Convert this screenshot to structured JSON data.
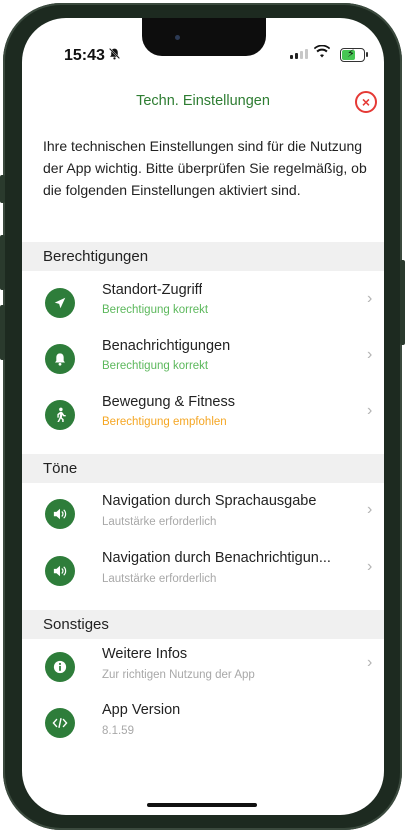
{
  "status_bar": {
    "time": "15:43",
    "mute_icon": "bell-slash-icon"
  },
  "header": {
    "title": "Techn. Einstellungen"
  },
  "intro_text": "Ihre technischen Einstellungen sind für die Nutzung der App wichtig. Bitte überprüfen Sie regelmäßig, ob die folgenden Einstellungen aktiviert sind.",
  "sections": {
    "permissions": {
      "title": "Berechtigungen",
      "items": [
        {
          "title": "Standort-Zugriff",
          "subtitle": "Berechtigung korrekt",
          "icon": "location-arrow-icon",
          "status": "ok"
        },
        {
          "title": "Benachrichtigungen",
          "subtitle": "Berechtigung korrekt",
          "icon": "bell-icon",
          "status": "ok"
        },
        {
          "title": "Bewegung & Fitness",
          "subtitle": "Berechtigung empfohlen",
          "icon": "walking-person-icon",
          "status": "recommended"
        }
      ]
    },
    "sounds": {
      "title": "Töne",
      "items": [
        {
          "title": "Navigation durch Sprachausgabe",
          "subtitle": "Lautstärke erforderlich",
          "icon": "speaker-icon"
        },
        {
          "title": "Navigation durch Benachrichtigun...",
          "subtitle": "Lautstärke erforderlich",
          "icon": "speaker-icon"
        }
      ]
    },
    "other": {
      "title": "Sonstiges",
      "items": [
        {
          "title": "Weitere Infos",
          "subtitle": "Zur richtigen Nutzung der App",
          "icon": "info-icon"
        },
        {
          "title": "App Version",
          "subtitle": "8.1.59",
          "icon": "code-icon"
        }
      ]
    }
  },
  "colors": {
    "accent": "#2e7d3a",
    "ok": "#5cb85c",
    "warning": "#f5a623",
    "close": "#e53935"
  }
}
